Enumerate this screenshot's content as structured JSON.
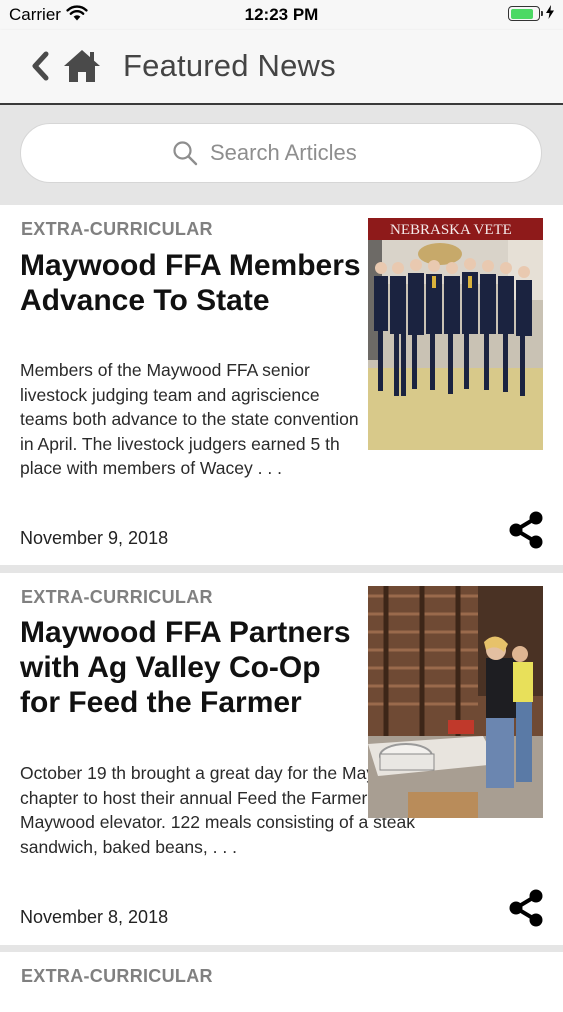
{
  "status_bar": {
    "carrier": "Carrier",
    "time": "12:23 PM",
    "battery_level": 0.84,
    "battery_color": "#4cd964"
  },
  "nav": {
    "back_icon": "chevron-left-icon",
    "home_icon": "home-icon",
    "title": "Featured News"
  },
  "search": {
    "placeholder": "Search Articles",
    "icon": "search-icon"
  },
  "articles": [
    {
      "category": "EXTRA-CURRICULAR",
      "title": "Maywood FFA Members Advance To State",
      "summary": "Members of the Maywood FFA senior livestock judging team and agriscience teams both advance to the state convention in April. The livestock judgers earned 5 th place with members of Wacey . . .",
      "date": "November 9, 2018",
      "banner_text": "NEBRASKA VETE",
      "share_icon": "share-icon"
    },
    {
      "category": "EXTRA-CURRICULAR",
      "title": "Maywood FFA Partners with Ag Valley Co-Op for Feed the Farmer",
      "summary": "October 19 th brought a great day for the Maywood FFA chapter to host their annual Feed the Farmer event at the Maywood elevator. 122 meals consisting of a steak sandwich, baked beans, . . .",
      "date": "November 8, 2018",
      "share_icon": "share-icon"
    },
    {
      "category": "EXTRA-CURRICULAR"
    }
  ],
  "colors": {
    "background": "#e5e5e5",
    "nav_background": "#f7f7f7",
    "category_text": "#808080",
    "ffa_blue": "#1b2340"
  }
}
